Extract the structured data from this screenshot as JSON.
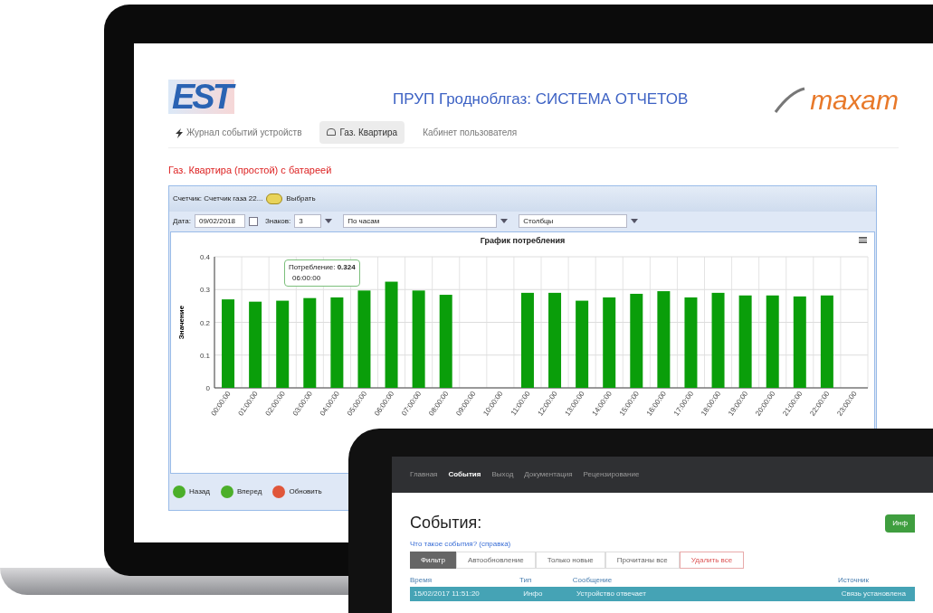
{
  "laptop": {
    "logo_left": "EST",
    "title": "ПРУП Гродноблгаз: СИСТЕМА ОТЧЕТОВ",
    "logo_right": "тахат",
    "tabs": [
      {
        "label": "Журнал событий устройств",
        "selected": false
      },
      {
        "label": "Газ. Квартира",
        "selected": true
      },
      {
        "label": "Кабинет пользователя",
        "selected": false
      }
    ],
    "page_title": "Газ. Квартира (простой) с батареей",
    "panel": {
      "meter_label": "Счетчик: Счетчик газа 22...",
      "choose_button": "Выбрать",
      "date_label": "Дата:",
      "date_value": "09/02/2018",
      "digits_label": "Знаков:",
      "digits_value": "3",
      "period_value": "По часам",
      "chart_type_value": "Столбцы",
      "chart_data": {
        "type": "bar",
        "title": "График потребления",
        "ylabel": "Значение",
        "categories": [
          "00:00:00",
          "01:00:00",
          "02:00:00",
          "03:00:00",
          "04:00:00",
          "05:00:00",
          "06:00:00",
          "07:00:00",
          "08:00:00",
          "09:00:00",
          "10:00:00",
          "11:00:00",
          "12:00:00",
          "13:00:00",
          "14:00:00",
          "15:00:00",
          "16:00:00",
          "17:00:00",
          "18:00:00",
          "19:00:00",
          "20:00:00",
          "21:00:00",
          "22:00:00",
          "23:00:00"
        ],
        "series": [
          {
            "color": "#0a9e0a",
            "values": [
              0.27,
              0.263,
              0.266,
              0.274,
              0.276,
              0.297,
              0.324,
              0.297,
              0.284,
              null,
              null,
              0.29,
              0.29,
              0.266,
              0.276,
              0.287,
              0.295,
              0.276,
              0.29,
              0.282,
              0.282,
              0.279,
              0.282,
              null
            ]
          }
        ],
        "ylim": [
          0,
          0.4
        ],
        "yticks": [
          0,
          0.1,
          0.2,
          0.3,
          0.4
        ],
        "grid": true
      },
      "tooltip": {
        "value": "Потребление: **0.324**",
        "time": "06:00:00"
      },
      "buttons": [
        "Назад",
        "Вперед",
        "Обновить"
      ]
    }
  },
  "tablet": {
    "nav": [
      {
        "label": "Главная",
        "selected": false
      },
      {
        "label": "События",
        "selected": true
      },
      {
        "label": "Выход",
        "selected": false
      },
      {
        "label": "Документация",
        "selected": false
      },
      {
        "label": "Рецензирование",
        "selected": false
      }
    ],
    "heading": "События:",
    "info_button": "Инф",
    "help_link": "Что такое события? (справка)",
    "toolbar": [
      {
        "label": "Фильтр",
        "kind": "dark"
      },
      {
        "label": "Автообновление",
        "kind": "plain"
      },
      {
        "label": "Только новые",
        "kind": "plain"
      },
      {
        "label": "Прочитаны все",
        "kind": "plain"
      },
      {
        "label": "Удалить все",
        "kind": "danger"
      }
    ],
    "columns": [
      "Время",
      "Тип",
      "Сообщение",
      "Источник"
    ],
    "rows": [
      {
        "cells": [
          "15/02/2017 11:51:20",
          "Инфо",
          "Устройство отвечает",
          "Связь установлена"
        ],
        "selected": true
      }
    ]
  }
}
